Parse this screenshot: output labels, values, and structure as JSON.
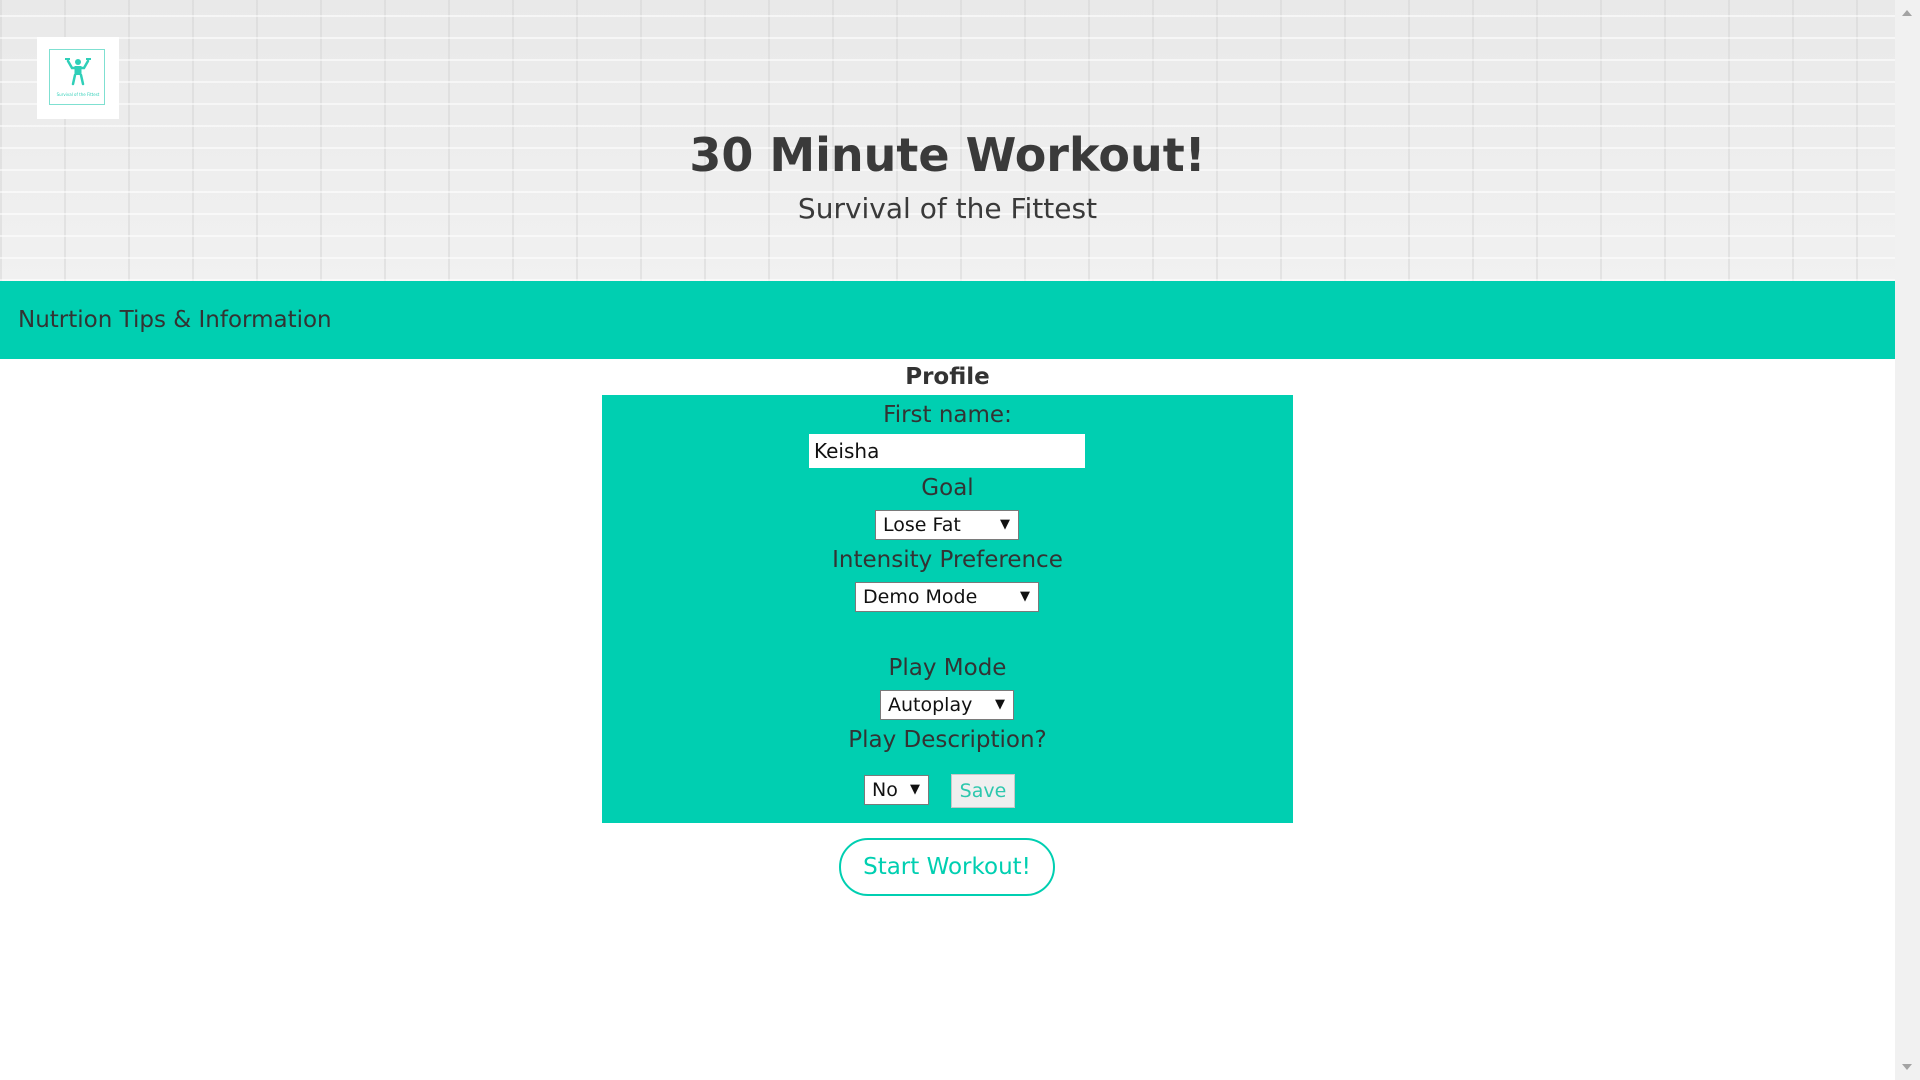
{
  "header": {
    "logo_text": "Survival of the Fittest",
    "title": "30 Minute Workout!",
    "subtitle": "Survival of the Fittest"
  },
  "nav": {
    "link_label": "Nutrtion Tips & Information"
  },
  "profile": {
    "heading": "Profile",
    "first_name_label": "First name:",
    "first_name_value": "Keisha",
    "goal_label": "Goal",
    "goal_selected": "Lose Fat",
    "intensity_label": "Intensity Preference",
    "intensity_selected": "Demo Mode",
    "play_mode_label": "Play Mode",
    "play_mode_selected": "Autoplay",
    "play_description_label": "Play Description?",
    "play_description_selected": "No",
    "save_label": "Save"
  },
  "actions": {
    "start_label": "Start Workout!"
  },
  "colors": {
    "accent": "#00cfb1",
    "header_bg": "#ededed",
    "text": "#333333"
  },
  "icons": {
    "logo": "strongman-icon",
    "dropdown": "caret-down-icon"
  }
}
